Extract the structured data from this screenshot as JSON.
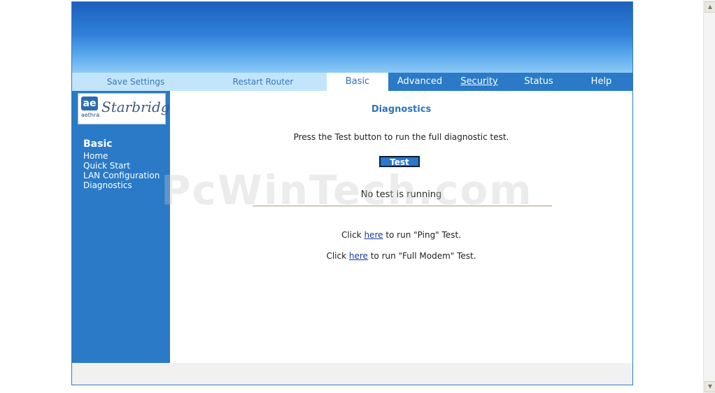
{
  "tabs": {
    "save_settings": "Save Settings",
    "restart_router": "Restart Router",
    "basic": "Basic",
    "advanced": "Advanced",
    "security": "Security",
    "status": "Status",
    "help": "Help"
  },
  "logo": {
    "mark": "ae",
    "sub": "aethra",
    "text": "Starbridge"
  },
  "sidebar": {
    "heading": "Basic",
    "items": [
      {
        "label": "Home"
      },
      {
        "label": "Quick Start"
      },
      {
        "label": "LAN Configuration"
      },
      {
        "label": "Diagnostics"
      }
    ]
  },
  "main": {
    "title": "Diagnostics",
    "instruction": "Press the Test button to run the full diagnostic test.",
    "test_button": "Test",
    "status": "No test is running",
    "ping": {
      "prefix": "Click ",
      "link": "here",
      "suffix": " to run \"Ping\" Test."
    },
    "modem": {
      "prefix": "Click ",
      "link": "here",
      "suffix": " to run \"Full Modem\" Test."
    }
  },
  "watermark": "PcWinTech.com",
  "colors": {
    "accent": "#2a7ac7",
    "tab_light": "#c2e5fb",
    "title": "#2b74bd"
  },
  "icons": {
    "scroll_up": "scroll-up-arrow-icon",
    "scroll_down": "scroll-down-arrow-icon"
  }
}
